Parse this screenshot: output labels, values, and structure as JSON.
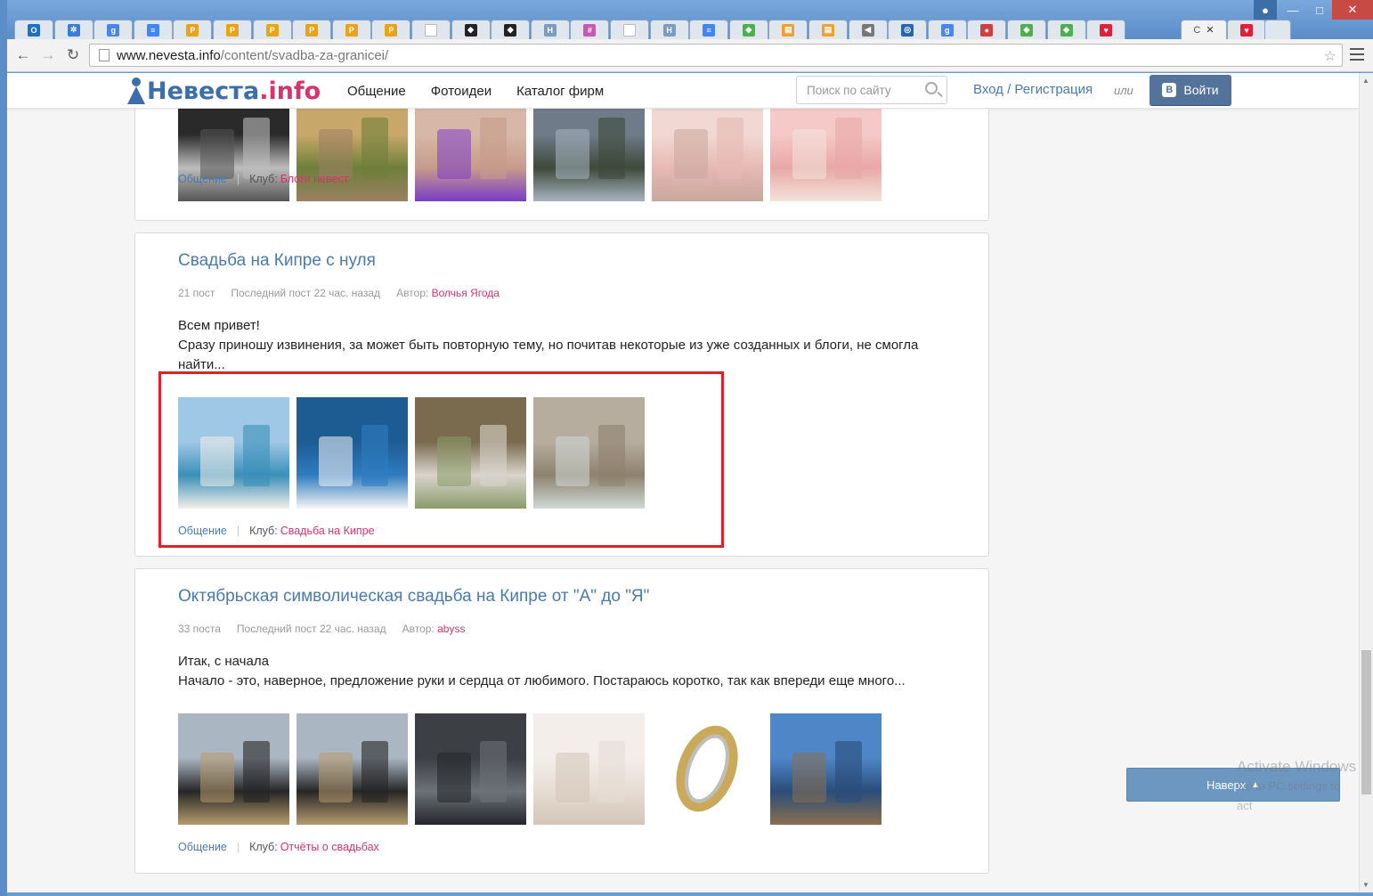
{
  "browser": {
    "address_host": "www.nevesta.info",
    "address_path": "/content/svadba-za-granicei/",
    "active_tab_label": "С",
    "tabs": [
      {
        "icon": "outlook-icon",
        "color": "#1e6fc4",
        "glyph": "O"
      },
      {
        "icon": "puzzle-icon",
        "color": "#3a7bd5",
        "glyph": "✲"
      },
      {
        "icon": "google-icon",
        "color": "#4a86e8",
        "glyph": "g"
      },
      {
        "icon": "docs-icon",
        "color": "#4285f4",
        "glyph": "≡"
      },
      {
        "icon": "pma-icon",
        "color": "#e8a317",
        "glyph": "P"
      },
      {
        "icon": "pma-icon",
        "color": "#e8a317",
        "glyph": "P"
      },
      {
        "icon": "pma-icon",
        "color": "#e8a317",
        "glyph": "P"
      },
      {
        "icon": "pma-icon",
        "color": "#e8a317",
        "glyph": "P"
      },
      {
        "icon": "pma-icon",
        "color": "#e8a317",
        "glyph": "P"
      },
      {
        "icon": "pma-icon",
        "color": "#e8a317",
        "glyph": "P"
      },
      {
        "icon": "blank-page-icon",
        "color": "#bbbbbb",
        "glyph": ""
      },
      {
        "icon": "diamond-icon",
        "color": "#222222",
        "glyph": "◆"
      },
      {
        "icon": "diamond-icon",
        "color": "#222222",
        "glyph": "◆"
      },
      {
        "icon": "h-icon",
        "color": "#7d9bbd",
        "glyph": "H"
      },
      {
        "icon": "slack-icon",
        "color": "#c45ab3",
        "glyph": "#"
      },
      {
        "icon": "blank-page-icon",
        "color": "#bbbbbb",
        "glyph": ""
      },
      {
        "icon": "h-icon",
        "color": "#7d9bbd",
        "glyph": "H"
      },
      {
        "icon": "docs-icon",
        "color": "#4285f4",
        "glyph": "≡"
      },
      {
        "icon": "gem-icon",
        "color": "#4caf50",
        "glyph": "◆"
      },
      {
        "icon": "file-icon",
        "color": "#f0a030",
        "glyph": "▤"
      },
      {
        "icon": "file-icon",
        "color": "#f0a030",
        "glyph": "▤"
      },
      {
        "icon": "sound-icon",
        "color": "#777777",
        "glyph": "◀"
      },
      {
        "icon": "globe-icon",
        "color": "#2a63b0",
        "glyph": "◎"
      },
      {
        "icon": "google-icon",
        "color": "#4a86e8",
        "glyph": "g"
      },
      {
        "icon": "people-icon",
        "color": "#d04040",
        "glyph": "●"
      },
      {
        "icon": "gem-icon",
        "color": "#4caf50",
        "glyph": "◆"
      },
      {
        "icon": "gem-icon",
        "color": "#4caf50",
        "glyph": "◆"
      },
      {
        "icon": "heart-icon",
        "color": "#e0203a",
        "glyph": "♥"
      }
    ],
    "last_tab_icon": "heart-icon"
  },
  "site": {
    "logo_main": "Невеста",
    "logo_suffix": ".info",
    "nav": [
      "Общение",
      "Фотоидеи",
      "Каталог фирм"
    ],
    "search_placeholder": "Поиск по сайту",
    "login_text": "Вход / Регистрация",
    "or_text": "или",
    "vk_button": "Войти",
    "vk_letter": "B",
    "brand_color": "#4a7aae",
    "accent_color": "#d4356c"
  },
  "posts": [
    {
      "category": "Общение",
      "club_label": "Клуб:",
      "club": "Блоги невест",
      "thumbs": [
        "bw-couple-photo",
        "castle-photo",
        "ring-hand-photo",
        "gothic-castle-photo",
        "pink-table-decor-photo",
        "pink-decor-collage-photo"
      ]
    },
    {
      "title": "Свадьба на Кипре с нуля",
      "count": "21 пост",
      "last_post": "Последний пост 22 час. назад",
      "author_label": "Автор:",
      "author": "Волчья Ягода",
      "text_line1": "Всем привет!",
      "text_line2": "Сразу приношу извинения, за может быть повторную тему, но почитав некоторые из уже созданных и блоги, не смогла найти...",
      "category": "Общение",
      "club_label": "Клуб:",
      "club": "Свадьба на Кипре",
      "thumbs": [
        "beach-arch-photo",
        "white-canopy-sea-photo",
        "pergola-chairs-photo",
        "stone-terrace-photo"
      ]
    },
    {
      "title": "Октябрьская символическая свадьба на Кипре от \"А\" до \"Я\"",
      "count": "33 поста",
      "last_post": "Последний пост 22 час. назад",
      "author_label": "Автор:",
      "author": "abyss",
      "text_line1": "Итак, с начала",
      "text_line2": "Начало - это, наверное, предложение руки и сердца от любимого. Постараюсь коротко, так как впереди еще много...",
      "category": "Общение",
      "club_label": "Клуб:",
      "club": "Отчёты о свадьбах",
      "thumbs": [
        "mariachi-photo",
        "mariachi-photo-2",
        "street-people-photo",
        "bride-dress-photo",
        "wedding-ring-photo",
        "coast-rocks-photo"
      ]
    }
  ],
  "to_top_label": "Наверх",
  "watermark": {
    "line1": "Activate Windows",
    "line2": "Go to PC settings to act"
  }
}
